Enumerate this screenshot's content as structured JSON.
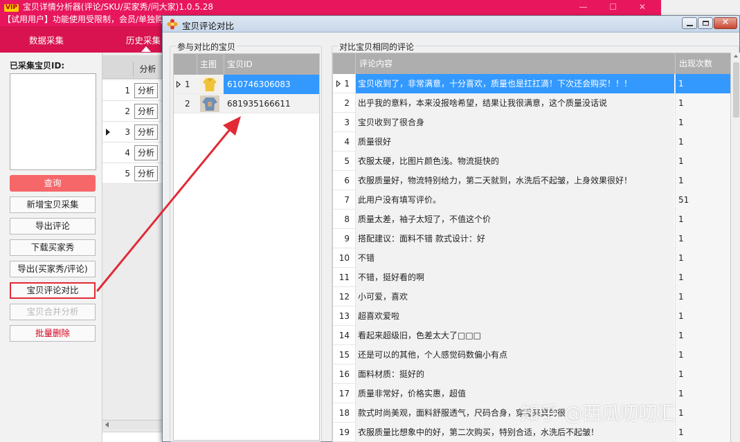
{
  "main": {
    "title": "宝贝详情分析器(评论/SKU/买家秀/问大家)1.0.5.28",
    "vip_badge": "VIP",
    "window_controls": "— ☐ ✕",
    "trial_notice": "【试用用户】功能使用受限制，会员/单独购",
    "nav_tabs": [
      "数据采集",
      "历史采集"
    ],
    "ids_label": "已采集宝贝ID:",
    "buttons": {
      "query": "查询",
      "new_collect": "新增宝贝采集",
      "export_comments": "导出评论",
      "download_show": "下载买家秀",
      "export_show_comments": "导出(买家秀/评论)",
      "compare": "宝贝评论对比",
      "merge": "宝贝合并分析",
      "batch_delete": "批量删除"
    },
    "grid": {
      "header": "分析",
      "rows": [
        {
          "n": "1",
          "action": "分析"
        },
        {
          "n": "2",
          "action": "分析"
        },
        {
          "n": "3",
          "action": "分析"
        },
        {
          "n": "4",
          "action": "分析"
        },
        {
          "n": "5",
          "action": "分析"
        }
      ]
    }
  },
  "dialog": {
    "title": "宝贝评论对比",
    "left_group": {
      "title": "参与对比的宝贝",
      "headers": [
        "主图",
        "宝贝ID"
      ],
      "rows": [
        {
          "n": "1",
          "id": "610746306083",
          "thumb": "yellow-garment"
        },
        {
          "n": "2",
          "id": "681935166611",
          "thumb": "denim-garment"
        }
      ]
    },
    "right_group": {
      "title": "对比宝贝相同的评论",
      "headers": [
        "评论内容",
        "出现次数"
      ],
      "rows": [
        {
          "n": "1",
          "text": "宝贝收到了，非常满意，十分喜欢，质量也是扛扛滴！下次还会购买！！！",
          "count": "1"
        },
        {
          "n": "2",
          "text": "出乎我的意料，本来没报啥希望，结果让我很满意，这个质量没话说",
          "count": "1"
        },
        {
          "n": "3",
          "text": "宝贝收到了很合身",
          "count": "1"
        },
        {
          "n": "4",
          "text": "质量很好",
          "count": "1"
        },
        {
          "n": "5",
          "text": "衣服太硬，比图片颜色浅。物流挺快的",
          "count": "1"
        },
        {
          "n": "6",
          "text": "衣服质量好，物流特别给力，第二天就到，水洗后不起皱，上身效果很好！",
          "count": "1"
        },
        {
          "n": "7",
          "text": "此用户没有填写评价。",
          "count": "51"
        },
        {
          "n": "8",
          "text": "质量太差，袖子太短了，不值这个价",
          "count": "1"
        },
        {
          "n": "9",
          "text": "搭配建议：面料不错 款式设计：好",
          "count": "1"
        },
        {
          "n": "10",
          "text": "不错",
          "count": "1"
        },
        {
          "n": "11",
          "text": "不错，挺好看的啊",
          "count": "1"
        },
        {
          "n": "12",
          "text": "小可爱，喜欢",
          "count": "1"
        },
        {
          "n": "13",
          "text": "超喜欢爱啦",
          "count": "1"
        },
        {
          "n": "14",
          "text": "看起来超级旧，色差太大了□□□",
          "count": "1"
        },
        {
          "n": "15",
          "text": "还是可以的其他，个人感觉码数偏小有点",
          "count": "1"
        },
        {
          "n": "16",
          "text": "面料材质：挺好的",
          "count": "1"
        },
        {
          "n": "17",
          "text": "质量非常好，价格实惠，超值",
          "count": "1"
        },
        {
          "n": "18",
          "text": "款式时尚美观，面料舒服透气，尺码合身，穿起来真的很",
          "count": "1"
        },
        {
          "n": "19",
          "text": "衣服质量比想象中的好，第二次购买，特别合适，水洗后不起皱！",
          "count": "1"
        }
      ]
    }
  },
  "watermark": "知乎 @西瓜叨叨汇",
  "colors": {
    "brand_red": "#e8175d",
    "selection_blue": "#3399ff",
    "annotation_red": "#e12a35",
    "grid_header": "#aeaeae"
  }
}
